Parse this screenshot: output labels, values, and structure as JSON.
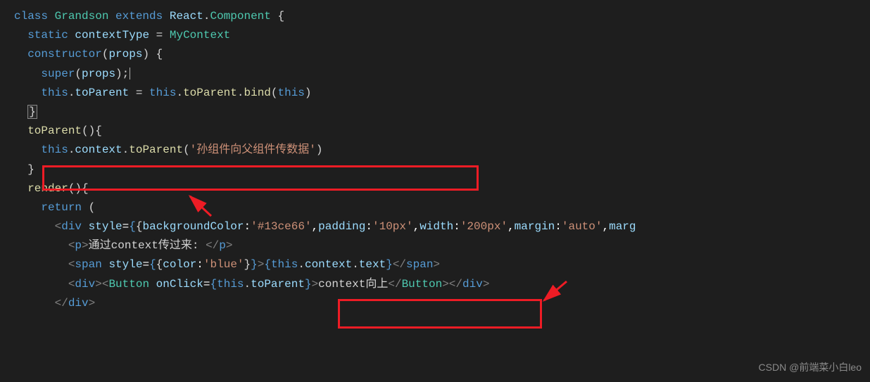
{
  "code": {
    "l1": {
      "class": "class ",
      "name": "Grandson",
      "extends": " extends ",
      "react": "React",
      "dot": ".",
      "component": "Component",
      "brace": " {"
    },
    "l2": {
      "indent": "  ",
      "static": "static ",
      "contextType": "contextType",
      "eq": " = ",
      "mycontext": "MyContext"
    },
    "l3": {
      "indent": "  ",
      "constructor": "constructor",
      "paren1": "(",
      "props": "props",
      "paren2": ")",
      "brace": " {"
    },
    "l4": {
      "indent": "    ",
      "super": "super",
      "paren1": "(",
      "props": "props",
      "paren2": ");"
    },
    "l5": {
      "indent": "    ",
      "this1": "this",
      "dot1": ".",
      "toParent1": "toParent",
      "eq": " = ",
      "this2": "this",
      "dot2": ".",
      "toParent2": "toParent",
      "dot3": ".",
      "bind": "bind",
      "paren1": "(",
      "this3": "this",
      "paren2": ")"
    },
    "l6": {
      "indent": "  ",
      "brace": "}"
    },
    "l7": {
      "indent": "  ",
      "toParent": "toParent",
      "paren": "()",
      "brace": "{"
    },
    "l8": {
      "indent": "    ",
      "this": "this",
      "dot1": ".",
      "context": "context",
      "dot2": ".",
      "toParent": "toParent",
      "paren1": "(",
      "str": "'孙组件向父组件传数据'",
      "paren2": ")"
    },
    "l9": {
      "indent": "  ",
      "brace": "}"
    },
    "l10": {
      "indent": "  ",
      "render": "render",
      "paren": "()",
      "brace": "{"
    },
    "l11": {
      "indent": "    ",
      "return": "return",
      "paren": " ("
    },
    "l12": {
      "indent": "      ",
      "open": "<",
      "div": "div",
      "sp": " ",
      "style": "style",
      "eq": "=",
      "b1": "{",
      "b2": "{",
      "bg": "backgroundColor",
      "c1": ":",
      "bgval": "'#13ce66'",
      "cm1": ",",
      "pad": "padding",
      "c2": ":",
      "padval": "'10px'",
      "cm2": ",",
      "wid": "width",
      "c3": ":",
      "widval": "'200px'",
      "cm3": ",",
      "mar": "margin",
      "c4": ":",
      "marval": "'auto'",
      "cm4": ",",
      "marg": "marg"
    },
    "l13": {
      "indent": "        ",
      "open": "<",
      "p": "p",
      "close1": ">",
      "text": "通过context传过来: ",
      "open2": "</",
      "p2": "p",
      "close2": ">"
    },
    "l14": {
      "indent": "        ",
      "open": "<",
      "span": "span",
      "sp": " ",
      "style": "style",
      "eq": "=",
      "b1": "{",
      "b2": "{",
      "color": "color",
      "c1": ":",
      "colorval": "'blue'",
      "b3": "}",
      "b4": "}",
      "close1": ">",
      "jb1": "{",
      "this": "this",
      "dot1": ".",
      "context": "context",
      "dot2": ".",
      "text": "text",
      "jb2": "}",
      "open2": "</",
      "span2": "span",
      "close2": ">"
    },
    "l15": {
      "indent": "        ",
      "open1": "<",
      "div1": "div",
      "close1": ">",
      "open2": "<",
      "button": "Button",
      "sp": " ",
      "onclick": "onClick",
      "eq": "=",
      "b1": "{",
      "this": "this",
      "dot": ".",
      "toParent": "toParent",
      "b2": "}",
      "close2": ">",
      "text": "context向上",
      "open3": "</",
      "button2": "Button",
      "close3": ">",
      "open4": "</",
      "div2": "div",
      "close4": ">"
    },
    "l16": {
      "indent": "      ",
      "open": "</",
      "div": "div",
      "close": ">"
    }
  },
  "watermark": "CSDN @前端菜小白leo"
}
